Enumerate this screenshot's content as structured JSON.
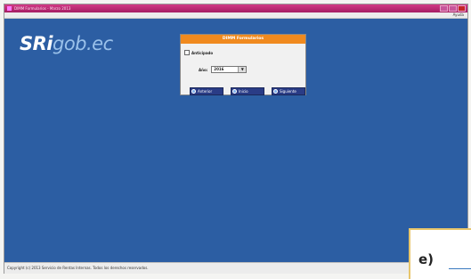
{
  "window": {
    "title": "DIMM Formularios - Marzo 2013"
  },
  "menubar": {
    "help": "Ayuda"
  },
  "logo": {
    "primary": "SRi",
    "secondary": "gob.ec"
  },
  "dialog": {
    "title": "DIMM Formularios",
    "checkbox_label": "Anticipado",
    "year_label": "Año:",
    "year_value": "2016",
    "buttons": [
      "Anterior",
      "Inicio",
      "Siguiente"
    ]
  },
  "statusbar": {
    "text": "Copyright (c) 2013 Servicio de Rentas Internas. Todos los derechos reservados."
  },
  "overlay_label": {
    "letter": "e)"
  },
  "colors": {
    "desktop": "#2c5ea3",
    "dialog_header": "#f08a1f",
    "button": "#2a3c86",
    "titlebar": "#b3246e"
  }
}
